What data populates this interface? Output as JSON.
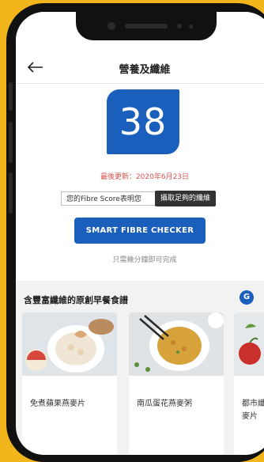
{
  "header": {
    "title": "營養及纖維"
  },
  "score": {
    "value": "38",
    "last_updated": "最後更新：2020年6月23日",
    "hint_button": "您的Fibre Score表明您",
    "tooltip": "攝取足夠的纖維",
    "checker_button": "SMART FIBRE CHECKER",
    "subtext": "只需幾分鐘即可完成"
  },
  "recipes": {
    "title": "含豐富纖維的原創早餐食譜",
    "badge": "G",
    "items": [
      {
        "name": "免煮蘋果燕麥片",
        "image": "apple-oats-bowl"
      },
      {
        "name": "南瓜蛋花燕麥粥",
        "image": "pumpkin-porridge-bowl"
      },
      {
        "name": "都市纖\n麥片",
        "image": "apple-dish"
      }
    ]
  },
  "colors": {
    "accent": "#1b5fbd",
    "background": "#f3b51c",
    "date": "#d9534f"
  }
}
